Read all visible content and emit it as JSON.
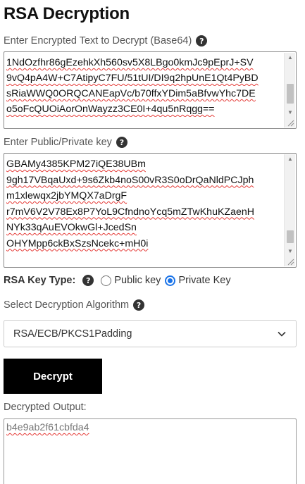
{
  "page": {
    "title": "RSA Decryption"
  },
  "encrypted": {
    "label": "Enter Encrypted Text to Decrypt (Base64)",
    "lines": [
      "1NdOzfhr86gEzehkXh560sv5X8LBgo0kmJc9pEprJ+SV",
      "9vQ4pA4W+C7AtipyC7FU/51tUI/DI9q2hpUnE1Qt4PyBD",
      "sRiaWWQ0ORQCANEapVc/b70ffxYDim5aBfvwYhc7DE",
      "o5oFcQUOiAorOnWayzz3CE0I+4qu5nRqgg=="
    ]
  },
  "key": {
    "label": "Enter Public/Private key",
    "lines": [
      "GBAMy4385KPM27iQE38UBm",
      "9gh17VBqaUxd+9s6Zkb4noS00vR3S0oDrQaNldPCJph",
      "m1xlewqx2jbYMQX7aDrgF",
      "r7mV6V2V78Ex8P7YoL9CfndnoYcq5mZTwKhuKZaenH",
      "NYk33qAuEVOkwGl+JcedSn",
      "OHYMpp6ckBxSzsNcekc+mH0i"
    ]
  },
  "keytype": {
    "label": "RSA Key Type:",
    "options": [
      "Public key",
      "Private Key"
    ],
    "selected": "Private Key"
  },
  "algorithm": {
    "label": "Select Decryption Algorithm",
    "value": "RSA/ECB/PKCS1Padding"
  },
  "action": {
    "decrypt_label": "Decrypt"
  },
  "output": {
    "label": "Decrypted Output:",
    "value": "b4e9ab2f61cbfda4"
  },
  "colors": {
    "accent": "#1a73e8",
    "button_bg": "#000000",
    "spellcheck": "#e53935"
  }
}
